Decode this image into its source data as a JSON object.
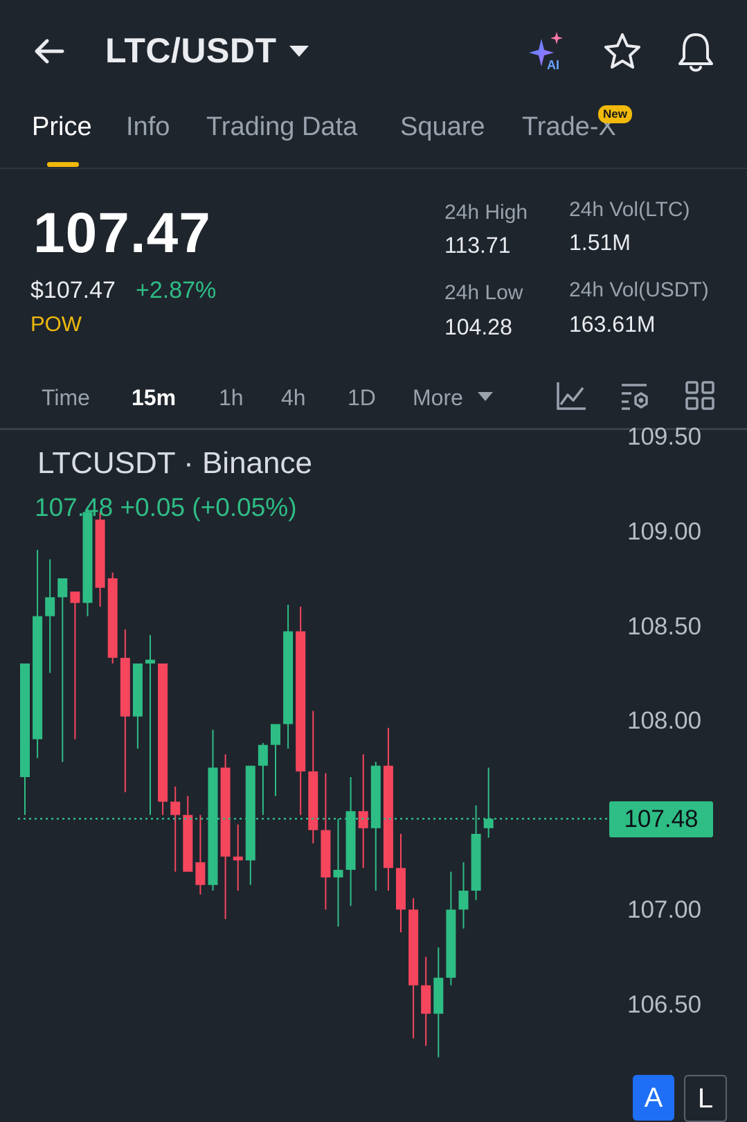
{
  "header": {
    "pair": "LTC/USDT",
    "icons": [
      "back-arrow-icon",
      "ai-sparkle-icon",
      "star-icon",
      "bell-icon"
    ]
  },
  "tabs": [
    {
      "label": "Price",
      "active": true
    },
    {
      "label": "Info",
      "active": false
    },
    {
      "label": "Trading Data",
      "active": false
    },
    {
      "label": "Square",
      "active": false
    },
    {
      "label": "Trade-X",
      "active": false,
      "badge": "New"
    }
  ],
  "ticker": {
    "last_price": "107.47",
    "usd_price": "$107.47",
    "change_pct": "+2.87%",
    "tag": "POW",
    "high_label": "24h High",
    "high_value": "113.71",
    "low_label": "24h Low",
    "low_value": "104.28",
    "vol_ltc_label": "24h Vol(LTC)",
    "vol_ltc_value": "1.51M",
    "vol_usdt_label": "24h Vol(USDT)",
    "vol_usdt_value": "163.61M"
  },
  "intervals": [
    {
      "label": "Time",
      "active": false
    },
    {
      "label": "15m",
      "active": true
    },
    {
      "label": "1h",
      "active": false
    },
    {
      "label": "4h",
      "active": false
    },
    {
      "label": "1D",
      "active": false
    },
    {
      "label": "More",
      "active": false
    }
  ],
  "toolbar_icons": [
    "indicator-chart-icon",
    "chart-settings-icon",
    "layout-grid-icon"
  ],
  "chart": {
    "title": "LTCUSDT · Binance",
    "ohlc": "107.48  +0.05 (+0.05%)",
    "current_price": "107.48",
    "y_labels": [
      "109.50",
      "109.00",
      "108.50",
      "108.00",
      "107.48",
      "107.00",
      "106.50"
    ],
    "colors": {
      "up": "#2ebd85",
      "down": "#f6465d"
    }
  },
  "chart_data": {
    "type": "candlestick",
    "title": "LTCUSDT · Binance",
    "ylim": [
      106.1,
      109.55
    ],
    "y_ticks": [
      109.5,
      109.0,
      108.5,
      108.0,
      107.0,
      106.5
    ],
    "last_price": 107.48,
    "candles": [
      {
        "o": 107.7,
        "h": 107.95,
        "l": 107.5,
        "c": 108.3
      },
      {
        "o": 107.9,
        "h": 108.9,
        "l": 107.8,
        "c": 108.55
      },
      {
        "o": 108.55,
        "h": 108.85,
        "l": 108.25,
        "c": 108.65
      },
      {
        "o": 108.65,
        "h": 108.7,
        "l": 107.78,
        "c": 108.75
      },
      {
        "o": 108.68,
        "h": 108.55,
        "l": 107.9,
        "c": 108.62
      },
      {
        "o": 108.62,
        "h": 109.13,
        "l": 108.55,
        "c": 109.1
      },
      {
        "o": 109.06,
        "h": 109.1,
        "l": 108.6,
        "c": 108.7
      },
      {
        "o": 108.75,
        "h": 108.78,
        "l": 108.3,
        "c": 108.33
      },
      {
        "o": 108.33,
        "h": 108.48,
        "l": 107.62,
        "c": 108.02
      },
      {
        "o": 108.02,
        "h": 108.23,
        "l": 107.85,
        "c": 108.3
      },
      {
        "o": 108.3,
        "h": 108.45,
        "l": 107.5,
        "c": 108.32
      },
      {
        "o": 108.3,
        "h": 108.2,
        "l": 107.5,
        "c": 107.57
      },
      {
        "o": 107.57,
        "h": 107.65,
        "l": 107.2,
        "c": 107.5
      },
      {
        "o": 107.5,
        "h": 107.6,
        "l": 107.25,
        "c": 107.2
      },
      {
        "o": 107.25,
        "h": 107.5,
        "l": 107.08,
        "c": 107.13
      },
      {
        "o": 107.13,
        "h": 107.95,
        "l": 107.1,
        "c": 107.75
      },
      {
        "o": 107.75,
        "h": 107.82,
        "l": 106.95,
        "c": 107.28
      },
      {
        "o": 107.28,
        "h": 107.45,
        "l": 107.1,
        "c": 107.26
      },
      {
        "o": 107.26,
        "h": 107.64,
        "l": 107.13,
        "c": 107.76
      },
      {
        "o": 107.76,
        "h": 107.88,
        "l": 107.5,
        "c": 107.87
      },
      {
        "o": 107.87,
        "h": 107.95,
        "l": 107.6,
        "c": 107.98
      },
      {
        "o": 107.98,
        "h": 108.61,
        "l": 107.85,
        "c": 108.47
      },
      {
        "o": 108.47,
        "h": 108.6,
        "l": 107.5,
        "c": 107.73
      },
      {
        "o": 107.73,
        "h": 108.05,
        "l": 107.35,
        "c": 107.42
      },
      {
        "o": 107.42,
        "h": 107.72,
        "l": 107.0,
        "c": 107.17
      },
      {
        "o": 107.17,
        "h": 107.48,
        "l": 106.91,
        "c": 107.21
      },
      {
        "o": 107.21,
        "h": 107.7,
        "l": 107.02,
        "c": 107.52
      },
      {
        "o": 107.52,
        "h": 107.82,
        "l": 107.22,
        "c": 107.43
      },
      {
        "o": 107.43,
        "h": 107.78,
        "l": 107.1,
        "c": 107.76
      },
      {
        "o": 107.76,
        "h": 107.96,
        "l": 107.1,
        "c": 107.22
      },
      {
        "o": 107.22,
        "h": 107.4,
        "l": 106.88,
        "c": 107.0
      },
      {
        "o": 107.0,
        "h": 107.06,
        "l": 106.32,
        "c": 106.6
      },
      {
        "o": 106.6,
        "h": 106.75,
        "l": 106.28,
        "c": 106.45
      },
      {
        "o": 106.45,
        "h": 106.8,
        "l": 106.22,
        "c": 106.64
      },
      {
        "o": 106.64,
        "h": 107.2,
        "l": 106.6,
        "c": 107.0
      },
      {
        "o": 107.0,
        "h": 107.25,
        "l": 106.9,
        "c": 107.1
      },
      {
        "o": 107.1,
        "h": 107.55,
        "l": 107.05,
        "c": 107.4
      },
      {
        "o": 107.43,
        "h": 107.75,
        "l": 107.38,
        "c": 107.48
      }
    ]
  }
}
